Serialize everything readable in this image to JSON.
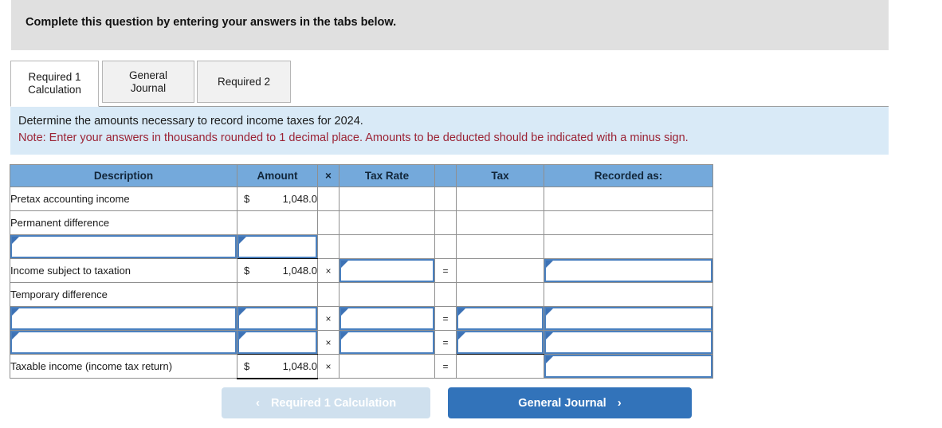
{
  "banner": {
    "text": "Complete this question by entering your answers in the tabs below."
  },
  "tabs": [
    {
      "label": "Required 1\nCalculation",
      "name": "tab-required-1-calculation",
      "active": true
    },
    {
      "label": "General\nJournal",
      "name": "tab-general-journal",
      "active": false
    },
    {
      "label": "Required 2",
      "name": "tab-required-2",
      "active": false
    }
  ],
  "instructions": {
    "line1": "Determine the amounts necessary to record income taxes for 2024.",
    "line2": "Note: Enter your answers in thousands rounded to 1 decimal place. Amounts to be deducted should be indicated with a minus sign."
  },
  "table": {
    "headers": {
      "description": "Description",
      "amount": "Amount",
      "multiply": "×",
      "tax_rate": "Tax Rate",
      "equals": "",
      "tax": "Tax",
      "recorded_as": "Recorded as:"
    },
    "operators": {
      "multiply": "×",
      "equals": "="
    },
    "currency": "$",
    "rows": [
      {
        "label": "Pretax accounting income",
        "amount": "1,048.0",
        "amount_currency": "$",
        "kind": "static"
      },
      {
        "label": "Permanent difference",
        "amount": "",
        "kind": "static-label-only"
      },
      {
        "label": "",
        "amount": "",
        "kind": "input-desc-amount"
      },
      {
        "label": "Income subject to taxation",
        "amount": "1,048.0",
        "amount_currency": "$",
        "tax_rate": "",
        "tax": "",
        "recorded_as": "",
        "kind": "subtotal-with-rate"
      },
      {
        "label": "Temporary difference",
        "amount": "",
        "kind": "static-label-only"
      },
      {
        "label": "",
        "amount": "",
        "tax_rate": "",
        "tax": "",
        "recorded_as": "",
        "kind": "input-full"
      },
      {
        "label": "",
        "amount": "",
        "tax_rate": "",
        "tax": "",
        "recorded_as": "",
        "kind": "input-full"
      },
      {
        "label": "Taxable income (income tax return)",
        "amount": "1,048.0",
        "amount_currency": "$",
        "recorded_as": "",
        "kind": "total"
      }
    ]
  },
  "footer": {
    "prev": {
      "label": "Required 1 Calculation",
      "chevron": "‹",
      "enabled": false
    },
    "next": {
      "label": "General Journal",
      "chevron": "›",
      "enabled": true
    }
  },
  "colors": {
    "banner_bg": "#e0e0e0",
    "instruction_bg": "#d9eaf7",
    "note_text": "#9b2335",
    "table_header_bg": "#74a9db",
    "input_border": "#4a80bf",
    "input_flag": "#3d72b5",
    "button_primary": "#3273ba",
    "button_disabled": "#cfe0ee"
  }
}
